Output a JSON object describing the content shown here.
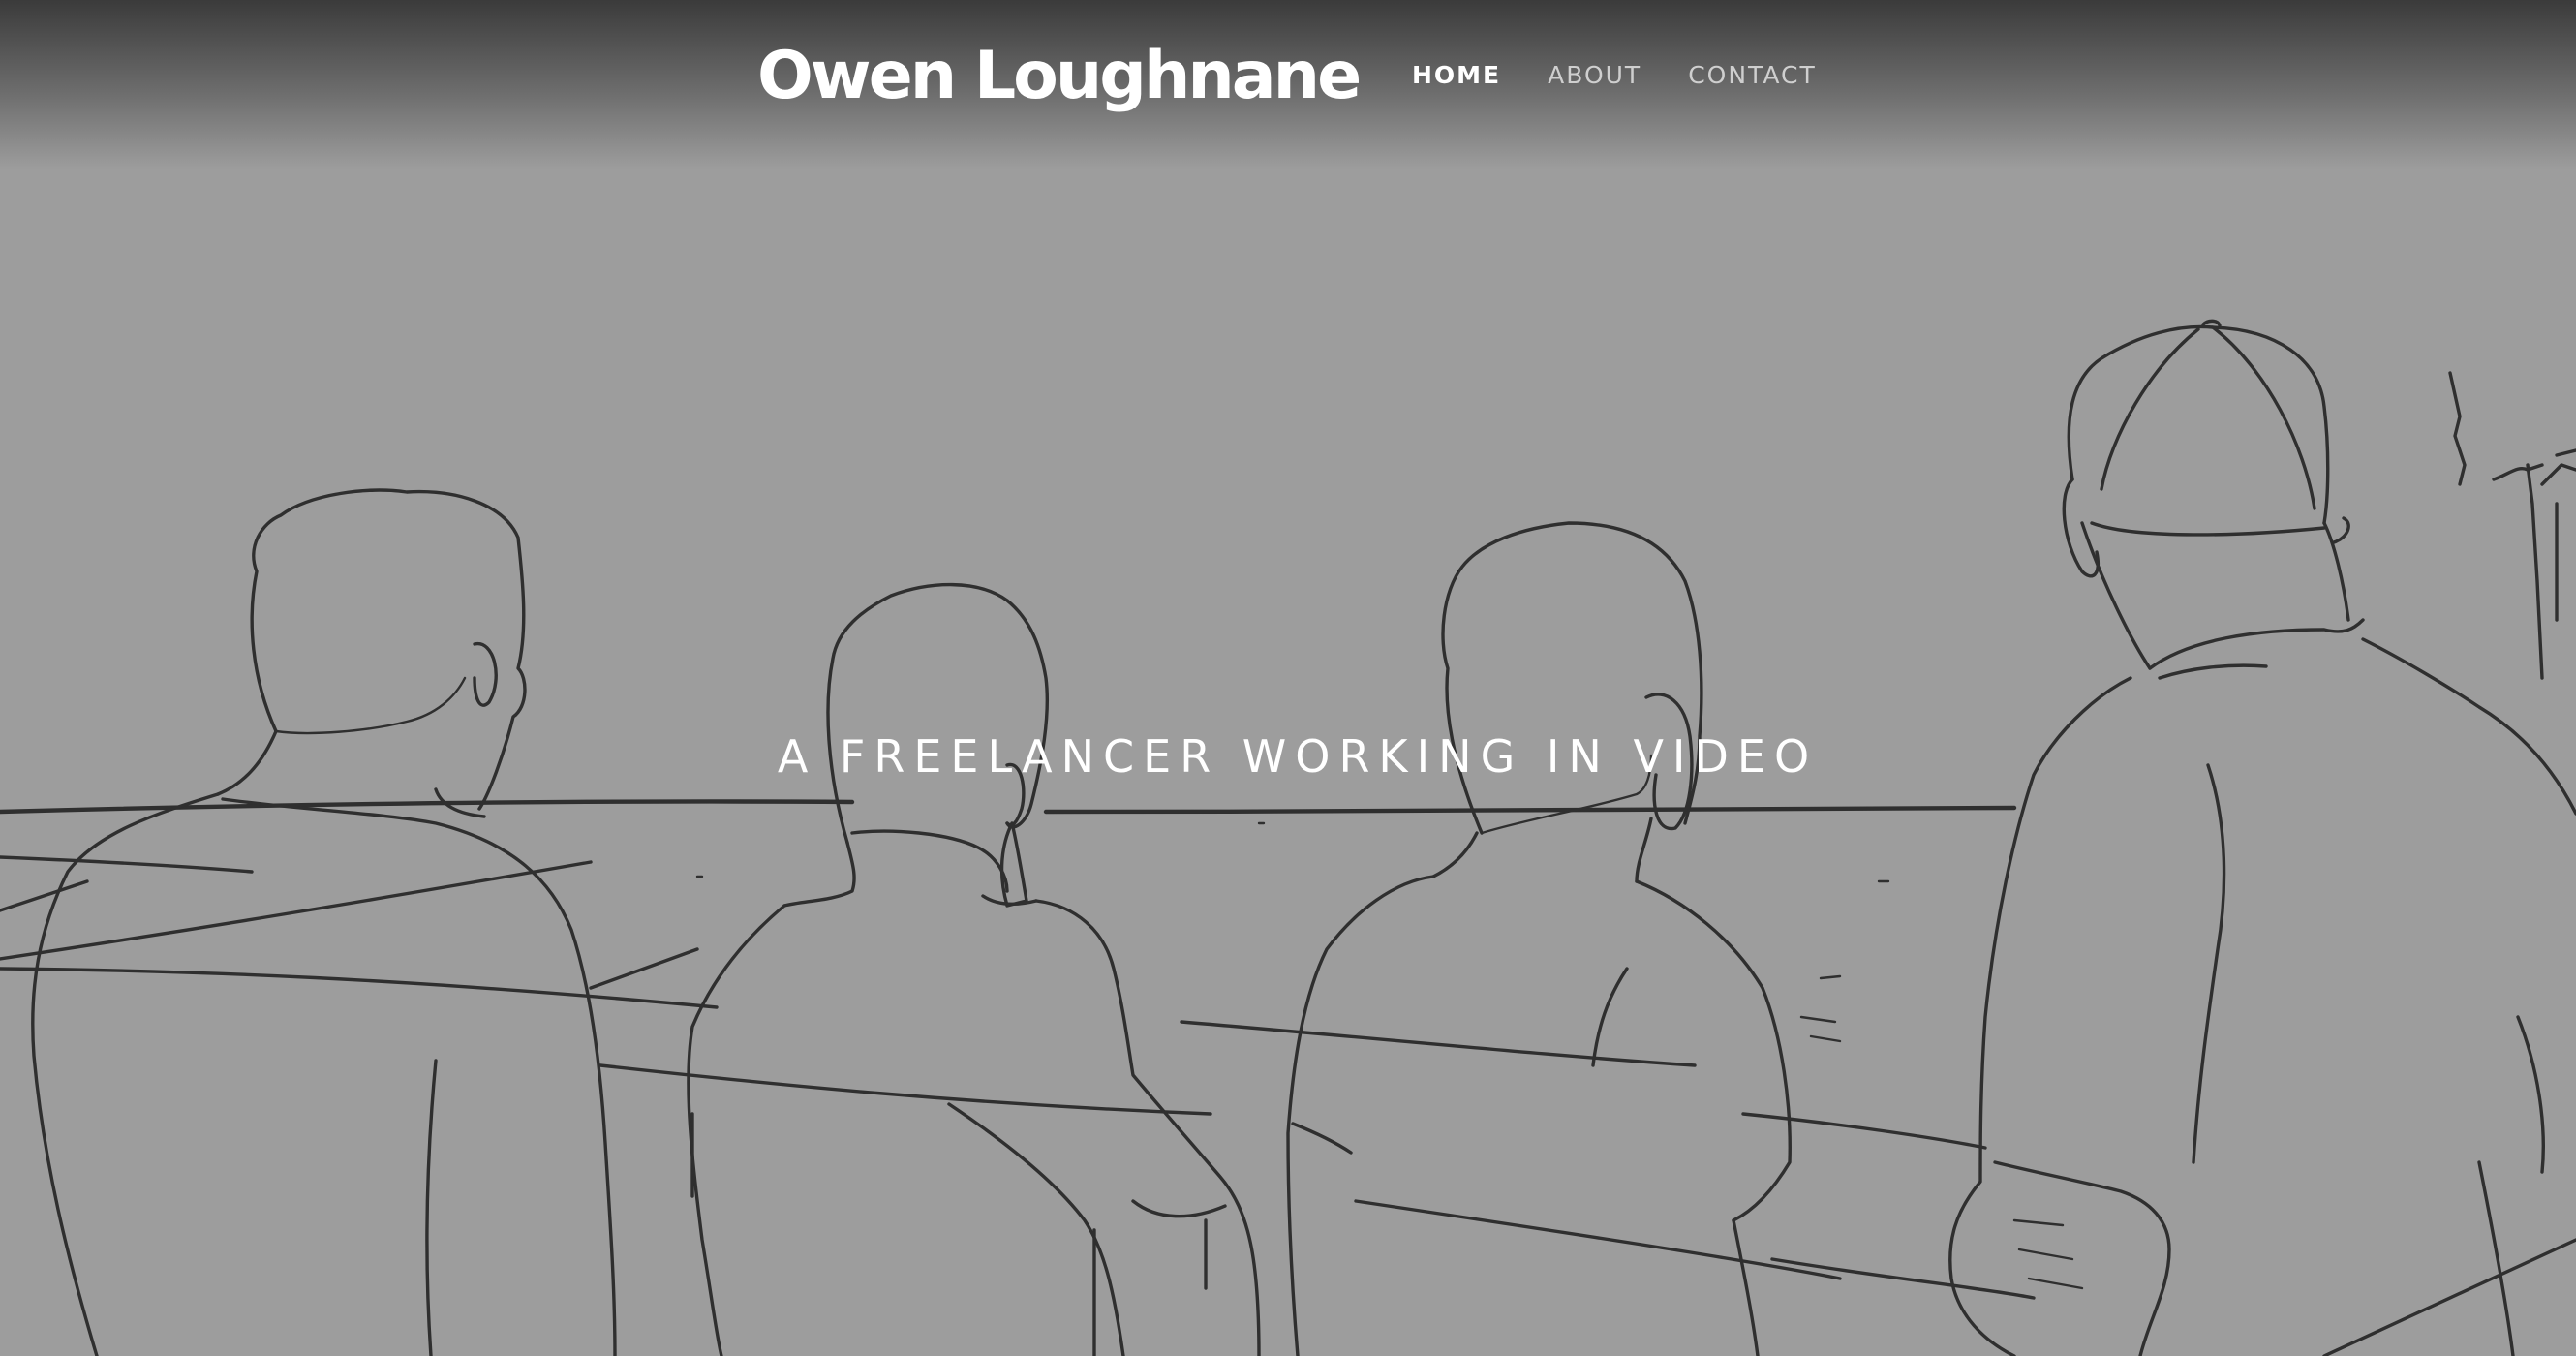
{
  "site": {
    "title": "Owen Loughnane",
    "tagline": "A FREELANCER WORKING IN VIDEO"
  },
  "nav": {
    "items": [
      {
        "label": "HOME",
        "active": true
      },
      {
        "label": "ABOUT",
        "active": false
      },
      {
        "label": "CONTACT",
        "active": false
      }
    ]
  },
  "hero": {
    "image": "pencil-sketch-four-men-at-railing",
    "background_color": "#9d9d9d",
    "line_color": "#2f2f2f"
  }
}
